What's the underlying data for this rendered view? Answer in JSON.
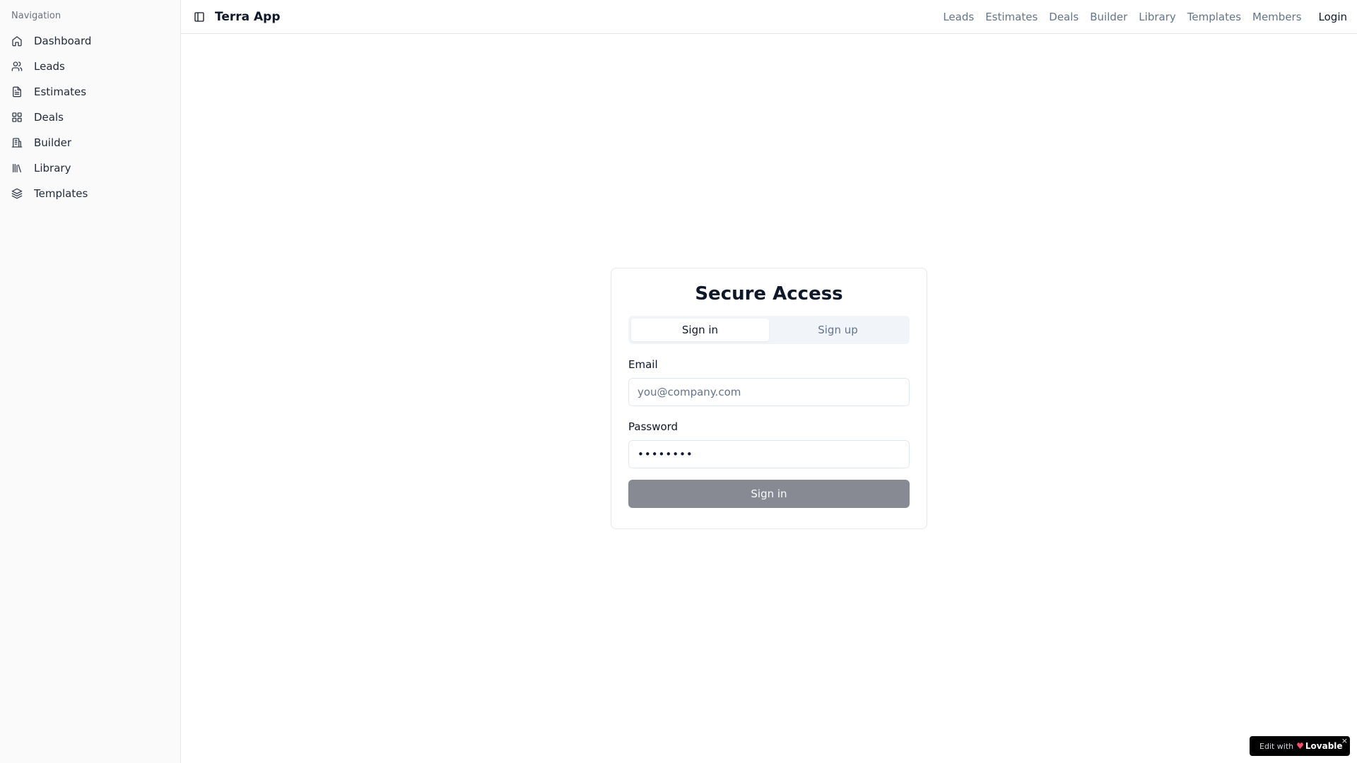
{
  "app": {
    "title": "Terra App"
  },
  "sidebar": {
    "heading": "Navigation",
    "items": [
      {
        "label": "Dashboard",
        "icon": "home-icon"
      },
      {
        "label": "Leads",
        "icon": "users-icon"
      },
      {
        "label": "Estimates",
        "icon": "file-text-icon"
      },
      {
        "label": "Deals",
        "icon": "grid-icon"
      },
      {
        "label": "Builder",
        "icon": "building-icon"
      },
      {
        "label": "Library",
        "icon": "library-icon"
      },
      {
        "label": "Templates",
        "icon": "layers-icon"
      }
    ]
  },
  "topnav": {
    "links": [
      "Leads",
      "Estimates",
      "Deals",
      "Builder",
      "Library",
      "Templates",
      "Members"
    ],
    "login": "Login"
  },
  "auth": {
    "title": "Secure Access",
    "tabs": {
      "signin": "Sign in",
      "signup": "Sign up",
      "active": "signin"
    },
    "email": {
      "label": "Email",
      "placeholder": "you@company.com",
      "value": ""
    },
    "password": {
      "label": "Password",
      "value": "password"
    },
    "submit_label": "Sign in"
  },
  "badge": {
    "edit_text": "Edit with",
    "brand": "Lovable",
    "close": "×"
  },
  "colors": {
    "submit_bg": "#878a92",
    "accent": "#0f172a",
    "muted": "#64748b"
  }
}
